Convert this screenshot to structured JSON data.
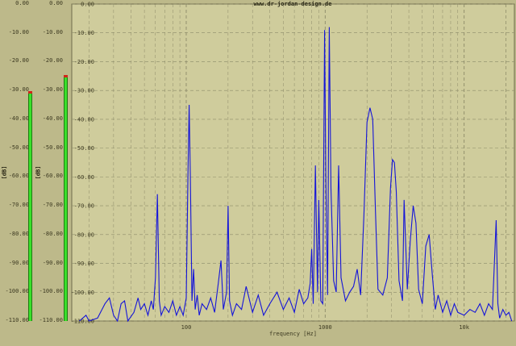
{
  "watermark": "www.dr-jordan-design.de",
  "meters": {
    "scale_labels": [
      "0.00",
      "-10.00",
      "-20.00",
      "-30.00",
      "-40.00",
      "-50.00",
      "-60.00",
      "-70.00",
      "-80.00",
      "-90.00",
      "-100.00",
      "-110.00"
    ],
    "unit": "[dB]",
    "left": {
      "level_db": -31,
      "peak_db": -30.5
    },
    "right": {
      "level_db": -25,
      "peak_db": -25
    }
  },
  "chart_data": {
    "type": "line",
    "xlabel": "frequency [Hz]",
    "ylabel": "[dB]",
    "x_scale": "log",
    "xlim": [
      15,
      23000
    ],
    "ylim": [
      -110,
      0
    ],
    "x_tick_labels": [
      {
        "value": 100,
        "label": "100"
      },
      {
        "value": 1000,
        "label": "1000"
      },
      {
        "value": 10000,
        "label": "10k"
      }
    ],
    "y_tick_labels": [
      "0.00",
      "-10.00",
      "-20.00",
      "-30.00",
      "-40.00",
      "-50.00",
      "-60.00",
      "-70.00",
      "-80.00",
      "-90.00",
      "-100.00",
      "-110.00"
    ],
    "grid": true,
    "colors": {
      "trace": "#1515d8",
      "grid": "#8c8a68",
      "plot_bg": "#cfcc9c",
      "meter": "#39e02a",
      "peak": "#d0261a"
    },
    "series": [
      {
        "points": [
          [
            17,
            -110
          ],
          [
            19,
            -108
          ],
          [
            20,
            -110
          ],
          [
            23,
            -109
          ],
          [
            26,
            -104
          ],
          [
            28,
            -102
          ],
          [
            30,
            -108
          ],
          [
            32,
            -110
          ],
          [
            34,
            -104
          ],
          [
            36,
            -103
          ],
          [
            38,
            -110
          ],
          [
            42,
            -107
          ],
          [
            45,
            -102
          ],
          [
            47,
            -106
          ],
          [
            50,
            -104
          ],
          [
            53,
            -108
          ],
          [
            56,
            -103
          ],
          [
            58,
            -106
          ],
          [
            60,
            -95
          ],
          [
            62,
            -66
          ],
          [
            64,
            -103
          ],
          [
            66,
            -108
          ],
          [
            70,
            -105
          ],
          [
            75,
            -107
          ],
          [
            80,
            -103
          ],
          [
            85,
            -108
          ],
          [
            90,
            -105
          ],
          [
            95,
            -108
          ],
          [
            100,
            -102
          ],
          [
            103,
            -58
          ],
          [
            105,
            -35
          ],
          [
            107,
            -60
          ],
          [
            110,
            -103
          ],
          [
            113,
            -92
          ],
          [
            116,
            -106
          ],
          [
            120,
            -101
          ],
          [
            124,
            -108
          ],
          [
            130,
            -104
          ],
          [
            140,
            -106
          ],
          [
            150,
            -102
          ],
          [
            160,
            -107
          ],
          [
            170,
            -97
          ],
          [
            178,
            -89
          ],
          [
            185,
            -106
          ],
          [
            195,
            -100
          ],
          [
            200,
            -70
          ],
          [
            205,
            -103
          ],
          [
            215,
            -108
          ],
          [
            230,
            -104
          ],
          [
            250,
            -106
          ],
          [
            270,
            -98
          ],
          [
            300,
            -107
          ],
          [
            330,
            -101
          ],
          [
            360,
            -108
          ],
          [
            400,
            -104
          ],
          [
            450,
            -100
          ],
          [
            500,
            -106
          ],
          [
            550,
            -102
          ],
          [
            600,
            -107
          ],
          [
            650,
            -99
          ],
          [
            700,
            -104
          ],
          [
            750,
            -102
          ],
          [
            780,
            -97
          ],
          [
            800,
            -85
          ],
          [
            820,
            -104
          ],
          [
            850,
            -56
          ],
          [
            880,
            -100
          ],
          [
            900,
            -68
          ],
          [
            930,
            -103
          ],
          [
            960,
            -104
          ],
          [
            990,
            -9
          ],
          [
            1010,
            -60
          ],
          [
            1040,
            -101
          ],
          [
            1070,
            -8
          ],
          [
            1100,
            -64
          ],
          [
            1150,
            -96
          ],
          [
            1200,
            -100
          ],
          [
            1250,
            -56
          ],
          [
            1300,
            -95
          ],
          [
            1400,
            -103
          ],
          [
            1500,
            -100
          ],
          [
            1600,
            -98
          ],
          [
            1700,
            -92
          ],
          [
            1800,
            -101
          ],
          [
            1900,
            -73
          ],
          [
            2000,
            -41
          ],
          [
            2100,
            -36
          ],
          [
            2200,
            -40
          ],
          [
            2300,
            -72
          ],
          [
            2400,
            -99
          ],
          [
            2600,
            -101
          ],
          [
            2800,
            -95
          ],
          [
            2950,
            -64
          ],
          [
            3050,
            -54
          ],
          [
            3150,
            -55
          ],
          [
            3250,
            -65
          ],
          [
            3400,
            -96
          ],
          [
            3600,
            -103
          ],
          [
            3700,
            -68
          ],
          [
            3900,
            -99
          ],
          [
            4100,
            -82
          ],
          [
            4300,
            -70
          ],
          [
            4500,
            -76
          ],
          [
            4700,
            -99
          ],
          [
            5000,
            -104
          ],
          [
            5300,
            -84
          ],
          [
            5600,
            -80
          ],
          [
            5900,
            -94
          ],
          [
            6200,
            -106
          ],
          [
            6500,
            -101
          ],
          [
            7000,
            -107
          ],
          [
            7500,
            -103
          ],
          [
            8000,
            -108
          ],
          [
            8500,
            -104
          ],
          [
            9000,
            -107
          ],
          [
            10000,
            -108
          ],
          [
            11000,
            -106
          ],
          [
            12000,
            -107
          ],
          [
            13000,
            -104
          ],
          [
            14000,
            -108
          ],
          [
            15000,
            -104
          ],
          [
            16000,
            -106
          ],
          [
            17000,
            -75
          ],
          [
            17500,
            -104
          ],
          [
            18000,
            -109
          ],
          [
            19000,
            -106
          ],
          [
            20000,
            -108
          ],
          [
            21000,
            -107
          ],
          [
            22000,
            -110
          ]
        ]
      }
    ]
  }
}
